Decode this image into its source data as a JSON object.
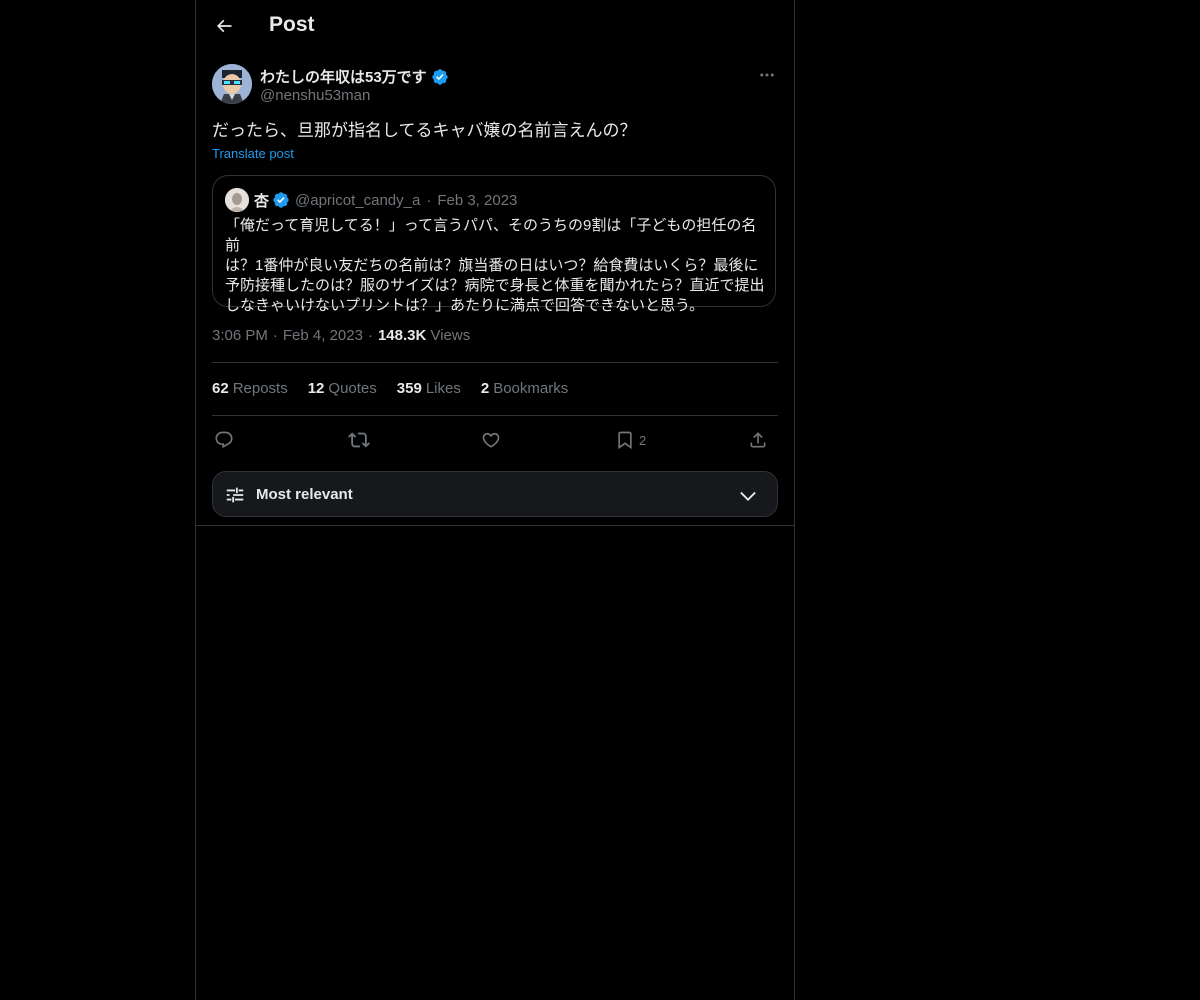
{
  "header": {
    "back_icon": "arrow-left-icon",
    "title": "Post"
  },
  "author": {
    "name": "わたしの年収は53万です",
    "handle": "@nenshu53man",
    "verified": true
  },
  "post": {
    "text": "だったら、旦那が指名してるキャバ嬢の名前言えんの？",
    "translate_label": "Translate post",
    "time": "3:06 PM",
    "date": "Feb 4, 2023",
    "views_count": "148.3K",
    "views_label": "Views"
  },
  "quote": {
    "name": "杏",
    "handle": "@apricot_candy_a",
    "date": "Feb 3, 2023",
    "text_lines": [
      "「俺だって育児してる！」って言うパパ、そのうちの9割は「子どもの担任の名前",
      "は？1番仲が良い友だちの名前は？旗当番の日はいつ？給食費はいくら？最後に",
      "予防接種したのは？服のサイズは？病院で身長と体重を聞かれたら？直近で提出",
      "しなきゃいけないプリントは？」あたりに満点で回答できないと思う。"
    ]
  },
  "stats": {
    "reposts_count": "62",
    "reposts_label": "Reposts",
    "quotes_count": "12",
    "quotes_label": "Quotes",
    "likes_count": "359",
    "likes_label": "Likes",
    "bookmarks_count": "2",
    "bookmarks_label": "Bookmarks"
  },
  "actions": {
    "reply_icon": "reply-icon",
    "repost_icon": "repost-icon",
    "like_icon": "heart-icon",
    "bookmark_icon": "bookmark-icon",
    "bookmark_count": "2",
    "share_icon": "share-icon"
  },
  "sort": {
    "label": "Most relevant",
    "icon": "sliders-icon",
    "chevron": "chevron-down-icon"
  },
  "colors": {
    "background": "#000000",
    "text": "#e7e9ea",
    "muted": "#71767b",
    "accent": "#1d9bf0",
    "border": "#2f3336"
  }
}
